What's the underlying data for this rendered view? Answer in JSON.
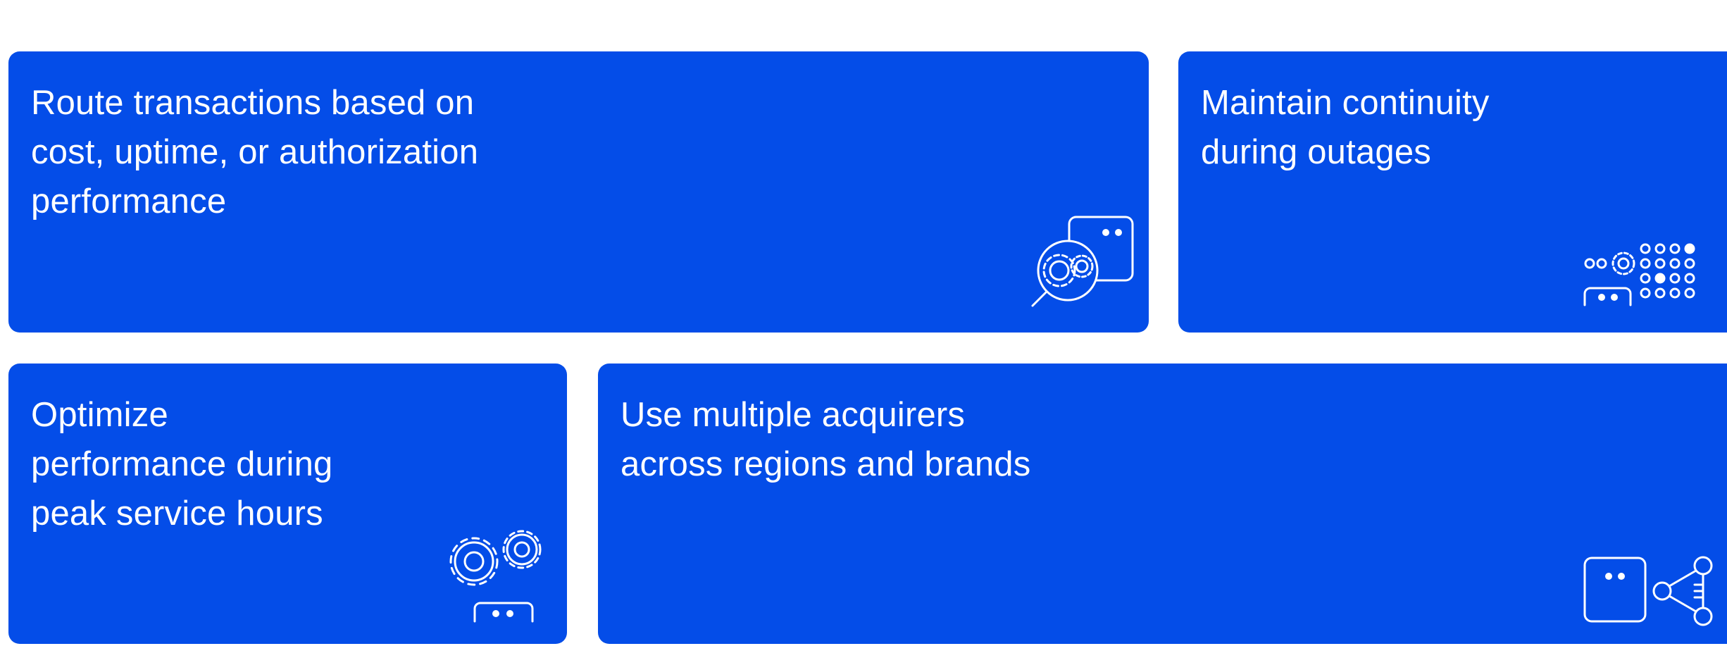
{
  "colors": {
    "card_background": "#044de8",
    "text": "#ffffff",
    "page_background": "#ffffff"
  },
  "cards": [
    {
      "text": "Route transactions based on\ncost, uptime, or authorization\nperformance",
      "icon": "card-magnifier-gears-icon"
    },
    {
      "text": "Maintain continuity\nduring outages",
      "icon": "card-dot-grid-gear-icon"
    },
    {
      "text": "Optimize\nperformance during\npeak service hours",
      "icon": "card-gears-icon"
    },
    {
      "text": "Use multiple acquirers\nacross regions and brands",
      "icon": "card-share-nodes-icon"
    }
  ]
}
